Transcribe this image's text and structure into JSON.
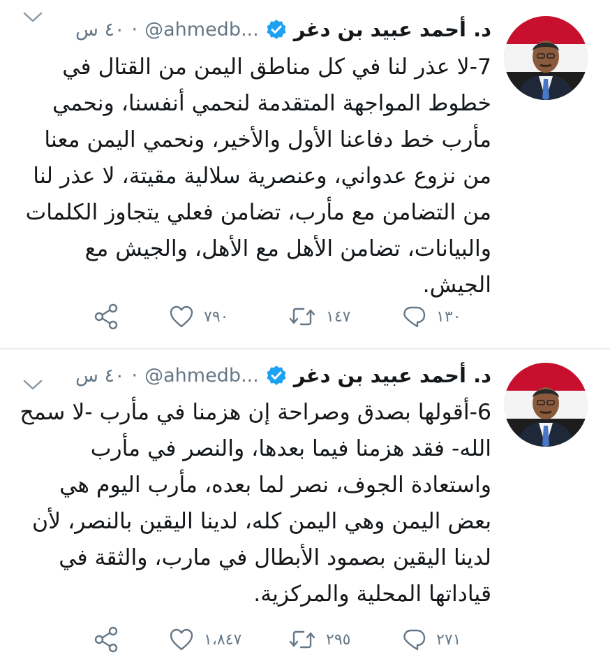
{
  "colors": {
    "verified": "#1da1f2",
    "secondary_text": "#657786",
    "primary_text": "#14171a",
    "divider": "#e6ecf0"
  },
  "tweets": [
    {
      "author": {
        "display_name": "د. أحمد عبيد بن دغر",
        "handle": "@ahmedb...",
        "verified_icon": "verified-badge-icon"
      },
      "time": "٤٠ س",
      "separator": "·",
      "body": "7-لا عذر لنا في كل مناطق اليمن من القتال في خطوط المواجهة المتقدمة لنحمي أنفسنا، ونحمي مأرب خط دفاعنا الأول والأخير، ونحمي اليمن معنا من نزوع عدواني، وعنصرية سلالية مقيتة، لا عذر لنا من التضامن مع مأرب، تضامن فعلي يتجاوز الكلمات والبيانات، تضامن الأهل مع الأهل، والجيش مع الجيش.",
      "stats": {
        "replies": "١٣٠",
        "retweets": "١٤٧",
        "likes": "٧٩٠"
      }
    },
    {
      "author": {
        "display_name": "د. أحمد عبيد بن دغر",
        "handle": "@ahmedb...",
        "verified_icon": "verified-badge-icon"
      },
      "time": "٤٠ س",
      "separator": "·",
      "body": "6-أقولها بصدق وصراحة إن هزمنا في مأرب -لا سمح الله- فقد هزمنا فيما بعدها، والنصر في مأرب واستعادة الجوف، نصر لما بعده، مأرب اليوم هي بعض اليمن وهي اليمن كله، لدينا اليقين بالنصر، لأن لدينا اليقين بصمود الأبطال في مارب، والثقة في قياداتها المحلية والمركزية.",
      "stats": {
        "replies": "٢٧١",
        "retweets": "٢٩٥",
        "likes": "١،٨٤٧"
      }
    }
  ]
}
